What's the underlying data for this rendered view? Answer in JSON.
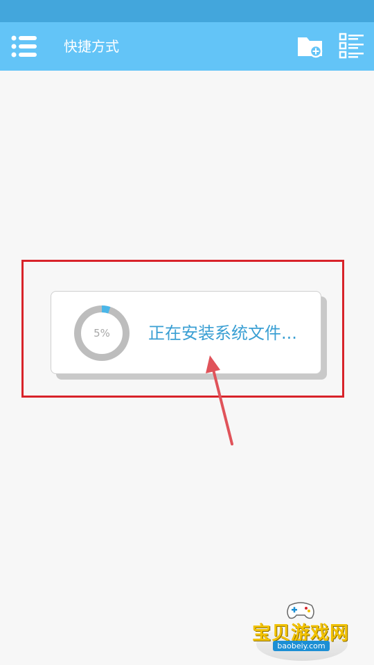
{
  "appbar": {
    "title": "快捷方式",
    "icons": [
      "menu-icon",
      "new-folder-icon",
      "list-view-icon"
    ]
  },
  "install_dialog": {
    "percent_text": "5%",
    "progress": 0.05,
    "message": "正在安装系统文件..."
  },
  "colors": {
    "statusbar": "#43a6dc",
    "appbar": "#63c4f7",
    "progress_fill": "#4ab6e8",
    "progress_track": "#bdbdbd",
    "message_text": "#3a9fd3",
    "annotation_red": "#d8232a"
  },
  "watermark": {
    "title": "宝贝游戏网",
    "url": "baobeiy.com"
  }
}
